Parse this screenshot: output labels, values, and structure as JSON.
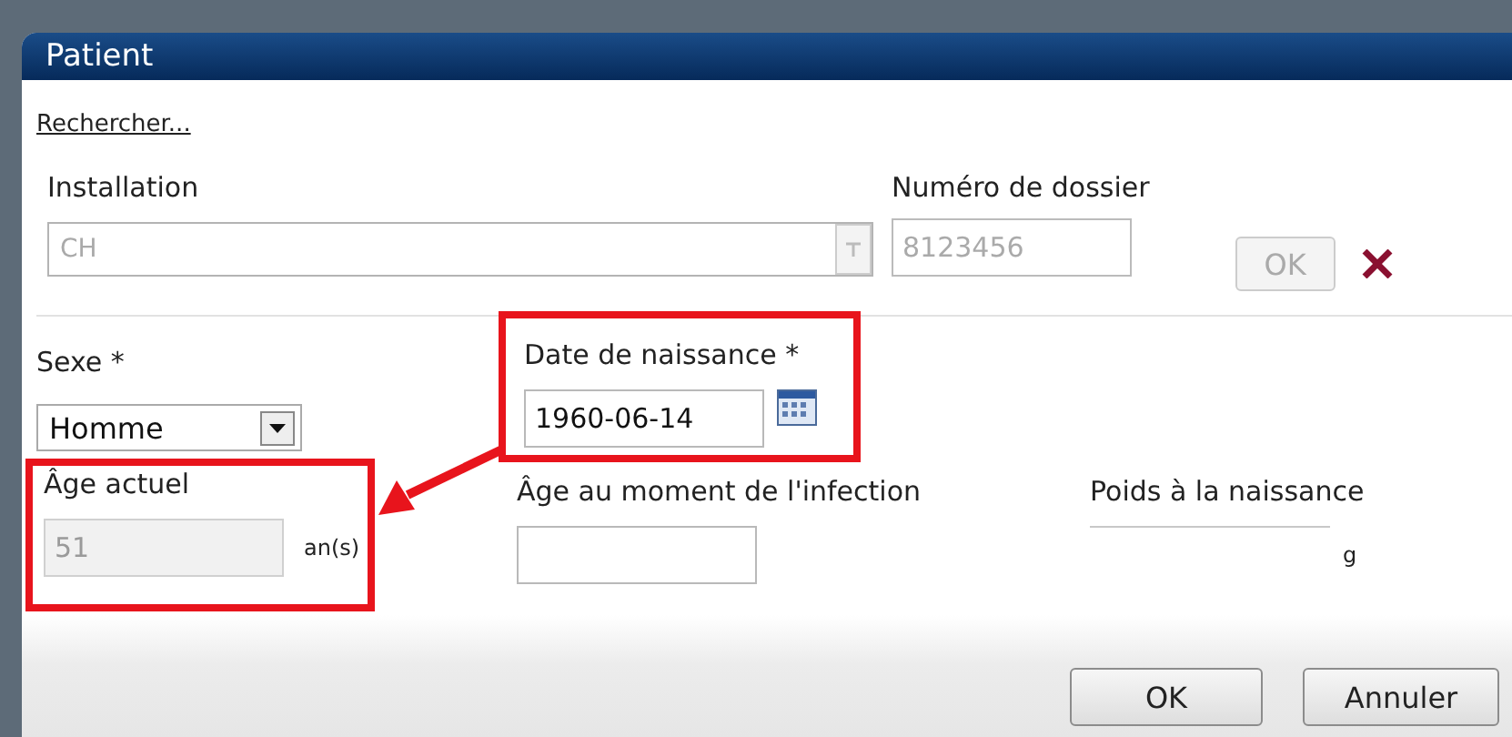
{
  "window": {
    "title": "Patient"
  },
  "search_link": "Rechercher...",
  "installation": {
    "label": "Installation",
    "value": "CH",
    "disabled": true
  },
  "file_number": {
    "label": "Numéro de dossier",
    "value": "8123456",
    "disabled": true
  },
  "file_ok_button": {
    "label": "OK",
    "disabled": true
  },
  "fields": [
    {
      "kind": "select",
      "label": "Sexe *",
      "value": "Homme",
      "highlighted": false
    },
    {
      "kind": "date",
      "label": "Date de naissance *",
      "value": "1960-06-14",
      "highlighted": true
    },
    {
      "kind": "number",
      "label": "Âge actuel",
      "value": "51",
      "unit": "an(s)",
      "disabled": true,
      "highlighted": true
    },
    {
      "kind": "number",
      "label": "Âge au moment de l'infection",
      "disabled": false,
      "highlighted": false
    },
    {
      "kind": "number",
      "label": "Poids à la naissance",
      "unit": "g",
      "disabled": false,
      "highlighted": false
    }
  ],
  "buttons": [
    {
      "label": "OK"
    },
    {
      "label": "Annuler"
    }
  ]
}
